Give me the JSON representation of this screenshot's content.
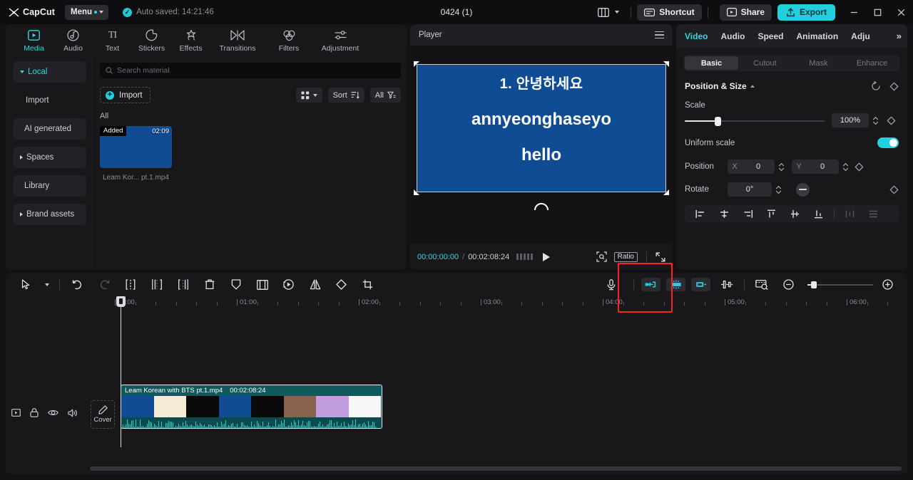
{
  "app": {
    "brand": "CapCut",
    "menu_label": "Menu",
    "autosave_text": "Auto saved: 14:21:46",
    "project_title": "0424 (1)"
  },
  "titlebar": {
    "layout_icon": "layout-icon",
    "shortcut_label": "Shortcut",
    "share_label": "Share",
    "export_label": "Export",
    "minimize": "–",
    "maximize": "▢",
    "close": "✕"
  },
  "nav_tabs": [
    {
      "label": "Media",
      "icon": "media-icon",
      "active": true
    },
    {
      "label": "Audio",
      "icon": "audio-icon",
      "active": false
    },
    {
      "label": "Text",
      "icon": "text-icon",
      "active": false
    },
    {
      "label": "Stickers",
      "icon": "sticker-icon",
      "active": false
    },
    {
      "label": "Effects",
      "icon": "effects-icon",
      "active": false
    },
    {
      "label": "Transitions",
      "icon": "transitions-icon",
      "active": false
    },
    {
      "label": "Filters",
      "icon": "filters-icon",
      "active": false
    },
    {
      "label": "Adjustment",
      "icon": "adjustment-icon",
      "active": false
    }
  ],
  "library_sidebar": [
    {
      "label": "Local",
      "active": true,
      "expandable": true
    },
    {
      "label": "Import",
      "active": false,
      "expandable": false
    },
    {
      "label": "AI generated",
      "active": false,
      "expandable": false
    },
    {
      "label": "Spaces",
      "active": false,
      "expandable": true
    },
    {
      "label": "Library",
      "active": false,
      "expandable": false
    },
    {
      "label": "Brand assets",
      "active": false,
      "expandable": true
    }
  ],
  "media_browser": {
    "search_placeholder": "Search material",
    "search_value": "",
    "import_label": "Import",
    "sort_label": "Sort",
    "filter_label": "All",
    "group_label": "All",
    "items": [
      {
        "badge": "Added",
        "duration": "02:09",
        "name": "Leam Kor... pt.1.mp4",
        "color": "#0f4c94"
      }
    ]
  },
  "player": {
    "title": "Player",
    "canvas_lines": [
      "1. 안녕하세요",
      "annyeonghaseyo",
      "hello"
    ],
    "canvas_color": "#0f4c94",
    "current_time": "00:00:00:00",
    "total_time": "00:02:08:24",
    "ratio_label": "Ratio"
  },
  "inspector": {
    "tabs": [
      {
        "label": "Video",
        "active": true
      },
      {
        "label": "Audio",
        "active": false
      },
      {
        "label": "Speed",
        "active": false
      },
      {
        "label": "Animation",
        "active": false
      },
      {
        "label": "Adju",
        "active": false
      }
    ],
    "more_icon": "chevron-double-right-icon",
    "segments": [
      {
        "label": "Basic",
        "active": true
      },
      {
        "label": "Cutout",
        "active": false
      },
      {
        "label": "Mask",
        "active": false
      },
      {
        "label": "Enhance",
        "active": false
      }
    ],
    "section_title": "Position & Size",
    "scale_label": "Scale",
    "scale_value": "100%",
    "uniform_scale_label": "Uniform scale",
    "uniform_scale_on": true,
    "position_label": "Position",
    "position_x_axis": "X",
    "position_x_value": "0",
    "position_y_axis": "Y",
    "position_y_value": "0",
    "rotate_label": "Rotate",
    "rotate_value": "0°",
    "align_buttons": [
      "align-left-icon",
      "align-center-horizontal-icon",
      "align-right-icon",
      "align-top-icon",
      "align-center-vertical-icon",
      "align-bottom-icon",
      "distribute-horizontal-icon",
      "distribute-vertical-icon"
    ]
  },
  "timeline": {
    "toolbar_left": [
      "select-tool-icon",
      "chevron-down-icon",
      "undo-icon",
      "redo-icon",
      "split-icon",
      "trim-left-icon",
      "trim-right-icon",
      "delete-icon",
      "freeze-icon",
      "crop-frame-icon",
      "speed-icon",
      "mirror-icon",
      "rotate-icon",
      "crop-icon"
    ],
    "record_icon": "microphone-icon",
    "toolbar_right": [
      "ripple-delete-left-icon",
      "auto-split-icon",
      "ripple-delete-right-icon",
      "mixer-icon",
      "keyframe-zoom-icon",
      "zoom-out-icon",
      "zoom-in-icon"
    ],
    "ruler_labels": [
      "00:00",
      "01:00",
      "02:00",
      "03:00",
      "04:00",
      "05:00",
      "06:00"
    ],
    "track_controls": [
      "track-thumbnail-icon",
      "lock-icon",
      "eye-icon",
      "volume-icon"
    ],
    "cover_label": "Cover",
    "clip": {
      "name": "Leam Korean with BTS pt.1.mp4",
      "duration": "00:02:08:24",
      "frame_colors": [
        "#0f4c94",
        "#f5ead3",
        "#0a0a0a",
        "#0f4c94",
        "#0a0a0a",
        "#8a6350",
        "#c29de0",
        "#f7f7f7"
      ]
    },
    "playhead_time": "00:00:00:00"
  },
  "highlight": {
    "target": "microphone-record-button",
    "color": "#ff2020"
  }
}
